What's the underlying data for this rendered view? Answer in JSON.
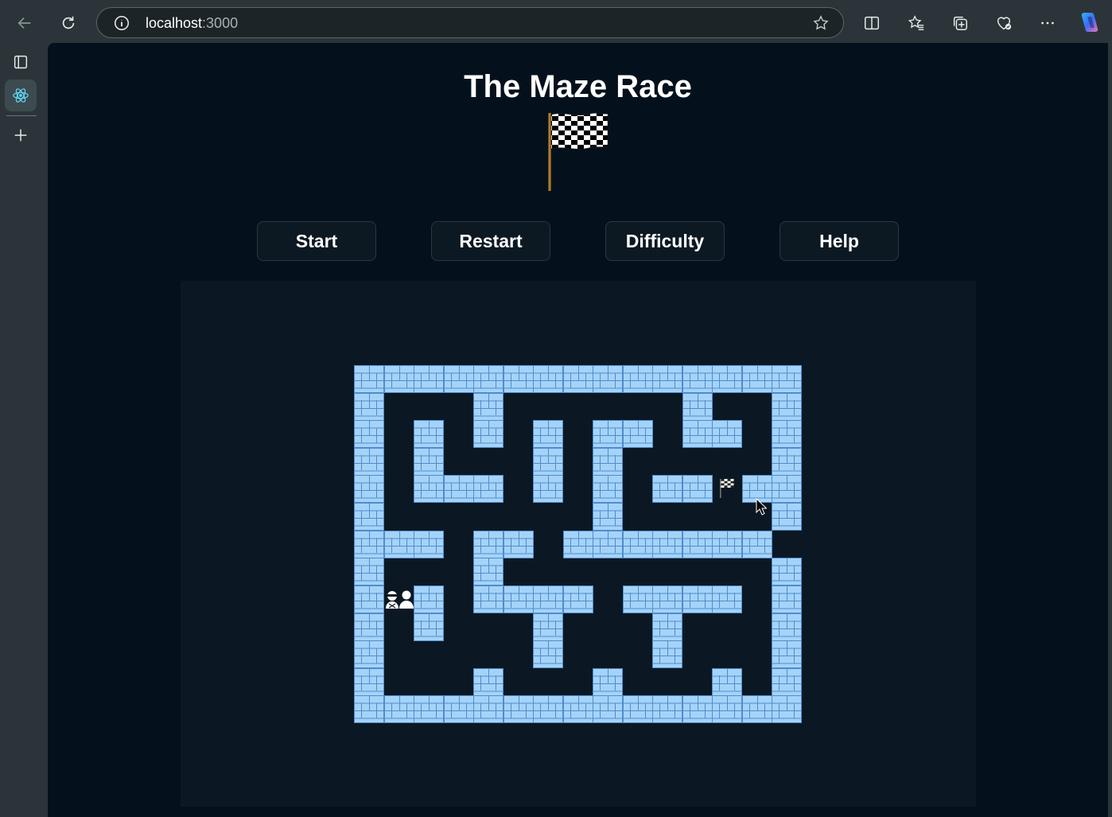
{
  "browser": {
    "url_host": "localhost",
    "url_port": ":3000",
    "icons": [
      "back-icon",
      "refresh-icon",
      "info-icon",
      "favorite-star-icon",
      "split-screen-icon",
      "favorites-icon",
      "collections-icon",
      "browser-essentials-icon",
      "more-icon",
      "copilot-icon"
    ],
    "sidebar_icons": [
      "tab-actions-icon",
      "react-devtools-icon",
      "add-icon"
    ]
  },
  "page": {
    "title": "The Maze Race",
    "buttons": {
      "start": "Start",
      "restart": "Restart",
      "difficulty": "Difficulty",
      "help": "Help"
    }
  },
  "maze": {
    "rows": [
      "###############",
      "#...#......#..#",
      "#.#.#.#.##.##.#",
      "#.#...#.#.....#",
      "#.###.#.#.##G##",
      "#.......#.....#",
      "###.##.#######.",
      "#...#.........#",
      "#P#.####.####.#",
      "#.#...#...#...#",
      "#.....#...#...#",
      "#...#...#...#.#",
      "###############"
    ],
    "legend": {
      "wall": "#",
      "path": ".",
      "goal": "G",
      "players": "P"
    },
    "colors": {
      "wall": "#a5d3f8",
      "mortar": "#4f8ccd",
      "floor": "#0b1823"
    }
  }
}
